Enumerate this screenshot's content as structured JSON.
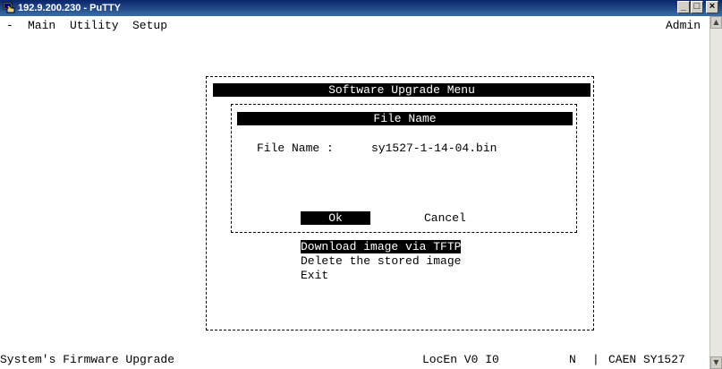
{
  "window": {
    "title": "192.9.200.230 - PuTTY",
    "minimize_glyph": "_",
    "maximize_glyph": "□",
    "close_glyph": "×"
  },
  "menubar": {
    "dash": "-",
    "items": [
      "Main",
      "Utility",
      "Setup"
    ],
    "user": "Admin"
  },
  "dialog": {
    "title": "Software Upgrade Menu",
    "file_panel": {
      "title": "File Name",
      "field_label": "File Name :",
      "field_value": "sy1527-1-14-04.bin",
      "ok_label": "Ok",
      "cancel_label": "Cancel"
    },
    "menu_items": [
      "Download image via TFTP",
      "Delete the stored image",
      "Exit"
    ]
  },
  "statusbar": {
    "left": "System's Firmware Upgrade",
    "mode": "LocEn V0 I0",
    "flag": "N",
    "separator": "|",
    "device": "CAEN SY1527"
  },
  "colors": {
    "titlebar": "#0a246a",
    "inverse_bg": "#000000",
    "inverse_fg": "#ffffff"
  }
}
